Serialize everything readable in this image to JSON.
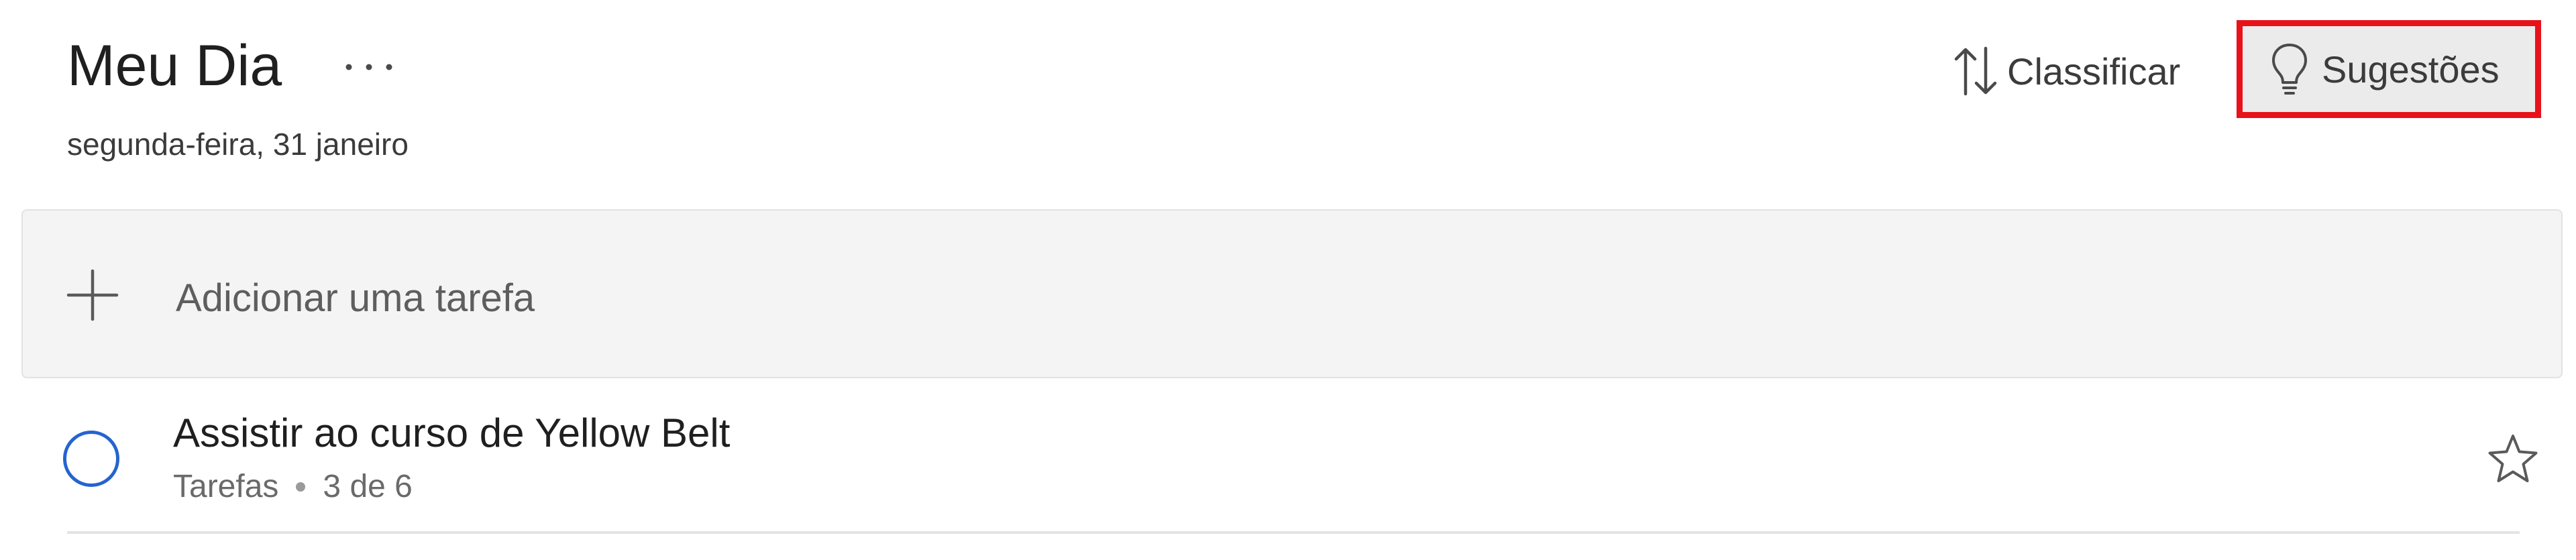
{
  "header": {
    "title": "Meu Dia",
    "date": "segunda-feira, 31 janeiro",
    "more_icon": "ellipsis-icon",
    "sort_label": "Classificar",
    "sort_icon": "sort-arrows-icon",
    "suggestions_label": "Sugestões",
    "suggestions_icon": "lightbulb-icon",
    "highlight_color": "#e8121a"
  },
  "add_task": {
    "placeholder": "Adicionar uma tarefa",
    "icon": "plus-icon"
  },
  "tasks": [
    {
      "title": "Assistir ao curso de Yellow Belt",
      "list": "Tarefas",
      "progress": "3 de 6",
      "checkbox_color": "#2564cf",
      "star_icon": "star-outline-icon"
    }
  ]
}
